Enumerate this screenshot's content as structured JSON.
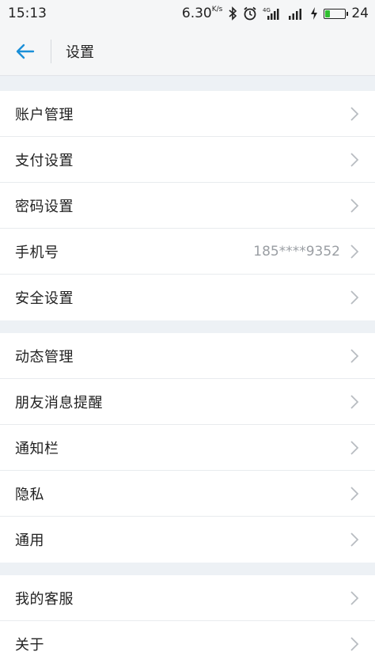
{
  "status_bar": {
    "time": "15:13",
    "net_speed": "6.30",
    "net_speed_unit": "K/s",
    "network_type": "4G",
    "battery_level": "24"
  },
  "header": {
    "title": "设置"
  },
  "sections": [
    {
      "items": [
        {
          "label": "账户管理"
        },
        {
          "label": "支付设置"
        },
        {
          "label": "密码设置"
        },
        {
          "label": "手机号",
          "value": "185****9352"
        },
        {
          "label": "安全设置"
        }
      ]
    },
    {
      "items": [
        {
          "label": "动态管理"
        },
        {
          "label": "朋友消息提醒"
        },
        {
          "label": "通知栏"
        },
        {
          "label": "隐私"
        },
        {
          "label": "通用"
        }
      ]
    },
    {
      "items": [
        {
          "label": "我的客服"
        },
        {
          "label": "关于"
        }
      ]
    }
  ],
  "colors": {
    "accent": "#1a8fd8",
    "background": "#edf1f5",
    "row_bg": "#ffffff",
    "chevron": "#b8bcc1",
    "battery": "#2fbf2f"
  }
}
